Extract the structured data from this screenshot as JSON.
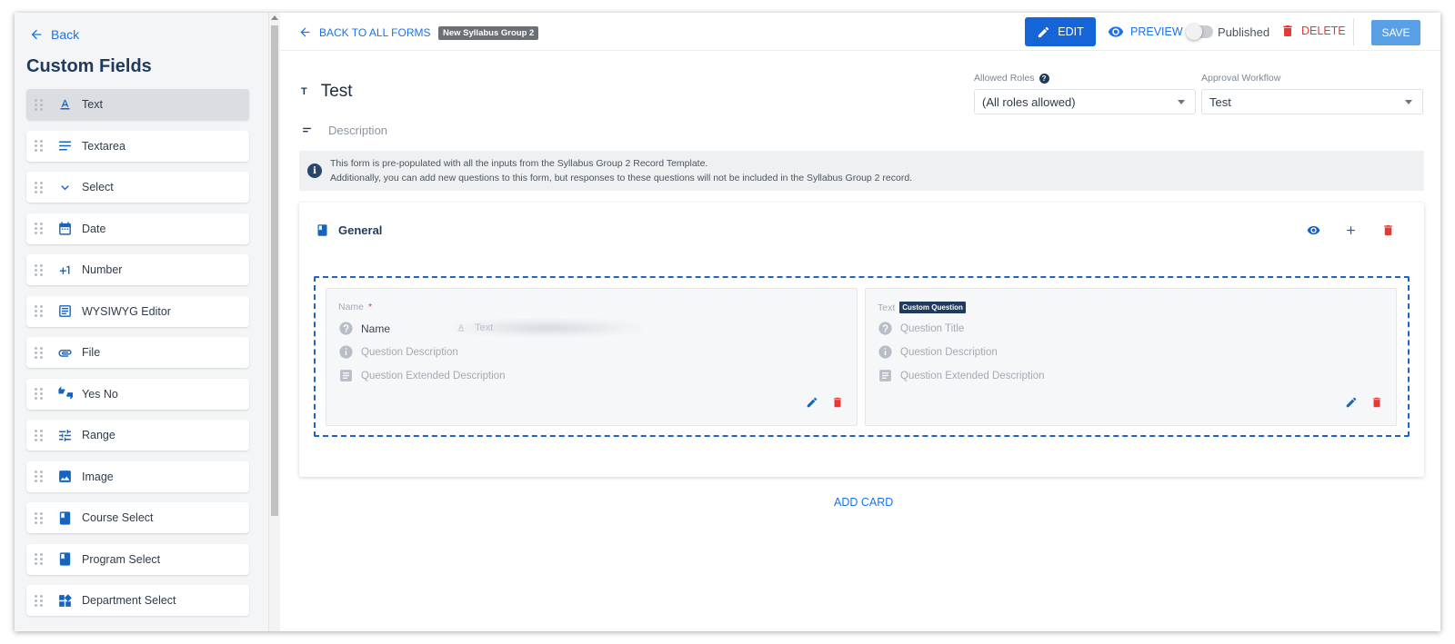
{
  "sidebar": {
    "back_label": "Back",
    "title": "Custom Fields",
    "fields": [
      {
        "label": "Text",
        "icon": "text-format-icon"
      },
      {
        "label": "Textarea",
        "icon": "textarea-lines-icon"
      },
      {
        "label": "Select",
        "icon": "chevron-down-icon"
      },
      {
        "label": "Date",
        "icon": "calendar-icon"
      },
      {
        "label": "Number",
        "icon": "plus-one-icon"
      },
      {
        "label": "WYSIWYG Editor",
        "icon": "editor-icon"
      },
      {
        "label": "File",
        "icon": "paperclip-icon"
      },
      {
        "label": "Yes No",
        "icon": "thumbs-up-down-icon"
      },
      {
        "label": "Range",
        "icon": "tune-sliders-icon"
      },
      {
        "label": "Image",
        "icon": "image-icon"
      },
      {
        "label": "Course Select",
        "icon": "book-icon"
      },
      {
        "label": "Program Select",
        "icon": "book-icon"
      },
      {
        "label": "Department Select",
        "icon": "widgets-icon"
      }
    ]
  },
  "topbar": {
    "back_label": "BACK TO ALL FORMS",
    "form_chip": "New Syllabus Group 2",
    "edit_label": "EDIT",
    "preview_label": "PREVIEW",
    "published_label": "Published",
    "delete_label": "DELETE",
    "save_label": "SAVE"
  },
  "form": {
    "title_icon": "T",
    "title": "Test",
    "description": "Description",
    "allowed_roles_label": "Allowed Roles",
    "allowed_roles_value": "(All roles allowed)",
    "approval_label": "Approval Workflow",
    "approval_value": "Test"
  },
  "info": {
    "line1": "This form is pre-populated with all the inputs from the Syllabus Group 2 Record Template.",
    "line2": "Additionally, you can add new questions to this form, but responses to these questions will not be included in the Syllabus Group 2 record."
  },
  "card": {
    "title": "General",
    "questions": [
      {
        "type_label": "Name",
        "required_mark": "*",
        "title": "Name",
        "description": "Question Description",
        "extended": "Question Extended Description",
        "ghost_label": "Text"
      },
      {
        "type_label": "Text",
        "badge": "Custom Question",
        "title": "Question Title",
        "description": "Question Description",
        "extended": "Question Extended Description"
      }
    ]
  },
  "add_card_label": "ADD CARD",
  "colors": {
    "primary": "#1565d8",
    "link": "#1a73e8",
    "danger": "#e53935",
    "navy": "#1f3a5c",
    "save": "#5aa0e6"
  }
}
